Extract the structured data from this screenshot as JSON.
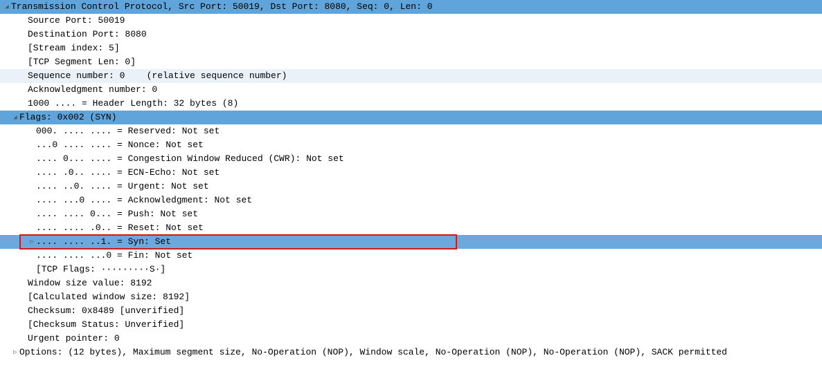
{
  "tcp_header": "Transmission Control Protocol, Src Port: 50019, Dst Port: 8080, Seq: 0, Len: 0",
  "source_port": "Source Port: 50019",
  "destination_port": "Destination Port: 8080",
  "stream_index": "[Stream index: 5]",
  "segment_len": "[TCP Segment Len: 0]",
  "sequence_number": "Sequence number: 0    (relative sequence number)",
  "ack_number": "Acknowledgment number: 0",
  "header_length": "1000 .... = Header Length: 32 bytes (8)",
  "flags_header": "Flags: 0x002 (SYN)",
  "flags": {
    "reserved": "000. .... .... = Reserved: Not set",
    "nonce": "...0 .... .... = Nonce: Not set",
    "cwr": ".... 0... .... = Congestion Window Reduced (CWR): Not set",
    "ecn": ".... .0.. .... = ECN-Echo: Not set",
    "urgent": ".... ..0. .... = Urgent: Not set",
    "ack": ".... ...0 .... = Acknowledgment: Not set",
    "push": ".... .... 0... = Push: Not set",
    "reset": ".... .... .0.. = Reset: Not set",
    "syn": ".... .... ..1. = Syn: Set",
    "fin": ".... .... ...0 = Fin: Not set"
  },
  "tcp_flags_summary": "[TCP Flags: ·········S·]",
  "window_size": "Window size value: 8192",
  "calc_window": "[Calculated window size: 8192]",
  "checksum": "Checksum: 0x8489 [unverified]",
  "checksum_status": "[Checksum Status: Unverified]",
  "urgent_pointer": "Urgent pointer: 0",
  "options": "Options: (12 bytes), Maximum segment size, No-Operation (NOP), Window scale, No-Operation (NOP), No-Operation (NOP), SACK permitted"
}
